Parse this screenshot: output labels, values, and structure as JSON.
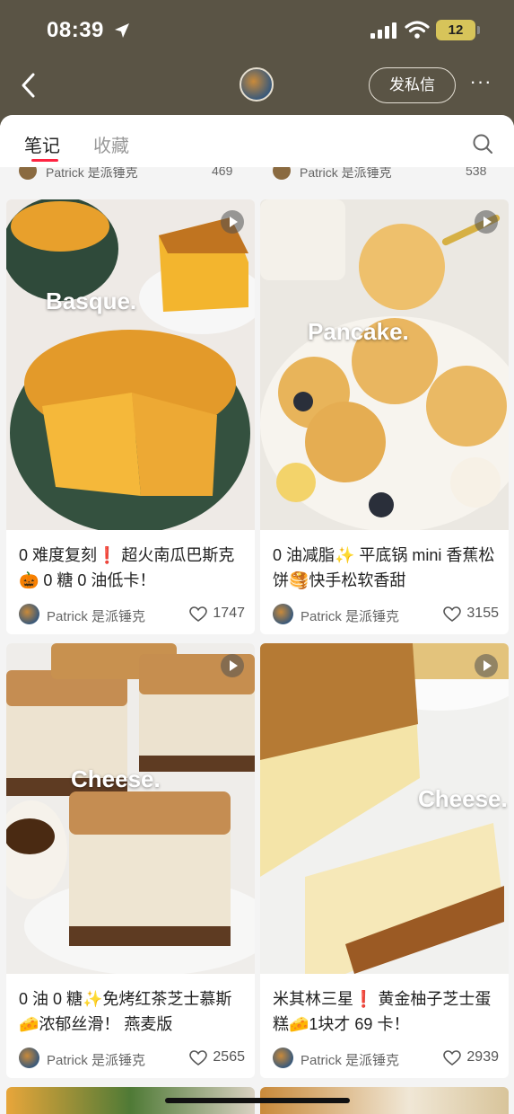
{
  "status_bar": {
    "time": "08:39",
    "battery": "12"
  },
  "header": {
    "dm_button": "发私信",
    "more": "···"
  },
  "tabs": {
    "notes": "笔记",
    "collections": "收藏"
  },
  "partial_row": [
    {
      "author": "Patrick 是派锤克",
      "likes": "469"
    },
    {
      "author": "Patrick 是派锤克",
      "likes": "538"
    }
  ],
  "cards": [
    {
      "image_text": "Basque.",
      "title": "0 难度复刻❗️ 超火南瓜巴斯克🎃 0 糖 0 油低卡！",
      "author": "Patrick 是派锤克",
      "likes": "1747"
    },
    {
      "image_text": "Pancake.",
      "title": "0 油减脂✨ 平底锅 mini 香蕉松饼🥞快手松软香甜",
      "author": "Patrick 是派锤克",
      "likes": "3155"
    },
    {
      "image_text": "Cheese.",
      "title": "0 油 0 糖✨免烤红茶芝士慕斯🧀浓郁丝滑！ 燕麦版",
      "author": "Patrick 是派锤克",
      "likes": "2565"
    },
    {
      "image_text": "Cheese.",
      "title": "米其林三星❗️ 黄金柚子芝士蛋糕🧀1块才 69 卡！",
      "author": "Patrick 是派锤克",
      "likes": "2939"
    }
  ],
  "colors": {
    "header_bg": "#5a5445",
    "accent": "#ff2442"
  }
}
